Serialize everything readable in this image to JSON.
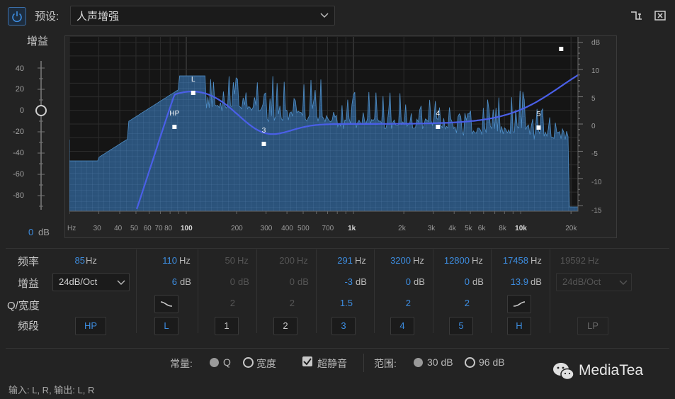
{
  "header": {
    "preset_label": "预设:",
    "preset_value": "人声增强",
    "icons": {
      "power": "power-icon",
      "routing": "routing-icon",
      "close": "close-icon",
      "chevron": "chevron-down-icon"
    }
  },
  "gain_scale": {
    "title": "增益",
    "ticks": [
      "40",
      "20",
      "0",
      "-20",
      "-40",
      "-60",
      "-80"
    ],
    "value": "0",
    "unit": "dB"
  },
  "graph": {
    "db_axis_label": "dB",
    "db_ticks": [
      "10",
      "5",
      "0",
      "-5",
      "-10",
      "-15"
    ],
    "freq_ticks": [
      "Hz",
      "30",
      "40",
      "50",
      "60",
      "70",
      "80",
      "100",
      "200",
      "300",
      "400",
      "500",
      "700",
      "1k",
      "2k",
      "3k",
      "4k",
      "5k",
      "6k",
      "8k",
      "10k",
      "20k"
    ],
    "band_markers": [
      {
        "label": "HP",
        "freq_hz": 85
      },
      {
        "label": "L",
        "freq_hz": 110
      },
      {
        "label": "3",
        "freq_hz": 291
      },
      {
        "label": "4",
        "freq_hz": 3200
      },
      {
        "label": "5",
        "freq_hz": 12800
      }
    ],
    "extra_marker_freq_hz": 17458,
    "accent_color": "#4a5fe8",
    "spectrum_color": "#2e5a86"
  },
  "bands": {
    "row_labels": {
      "freq": "频率",
      "gain": "增益",
      "q": "Q/宽度",
      "band": "频段"
    },
    "hp": {
      "freq": "85",
      "freq_unit": "Hz",
      "slope": "24dB/Oct",
      "button": "HP"
    },
    "columns": [
      {
        "id": "L",
        "freq": "110",
        "gain": "6",
        "q": "",
        "button": "L",
        "enabled": true
      },
      {
        "id": "1",
        "freq": "50",
        "gain": "0",
        "q": "2",
        "button": "1",
        "enabled": false
      },
      {
        "id": "2",
        "freq": "200",
        "gain": "0",
        "q": "2",
        "button": "2",
        "enabled": false
      },
      {
        "id": "3",
        "freq": "291",
        "gain": "-3",
        "q": "1.5",
        "button": "3",
        "enabled": true
      },
      {
        "id": "4",
        "freq": "3200",
        "gain": "0",
        "q": "2",
        "button": "4",
        "enabled": true
      },
      {
        "id": "5",
        "freq": "12800",
        "gain": "0",
        "q": "2",
        "button": "5",
        "enabled": true
      },
      {
        "id": "H",
        "freq": "17458",
        "gain": "13.9",
        "q": "",
        "button": "H",
        "enabled": true
      }
    ],
    "lp": {
      "freq": "19592",
      "freq_unit": "Hz",
      "slope": "24dB/Oct",
      "button": "LP"
    },
    "hz_unit": "Hz",
    "db_unit": "dB"
  },
  "options": {
    "constant_label": "常量:",
    "q_label": "Q",
    "width_label": "宽度",
    "ultra_quiet_label": "超静音",
    "ultra_quiet_checked": true,
    "range_label": "范围:",
    "range_30": "30 dB",
    "range_96": "96 dB",
    "constant_selected": "宽度",
    "range_selected": "96 dB"
  },
  "footer": {
    "io_text": "输入: L, R,  输出: L, R"
  },
  "brand": {
    "name": "MediaTea"
  }
}
